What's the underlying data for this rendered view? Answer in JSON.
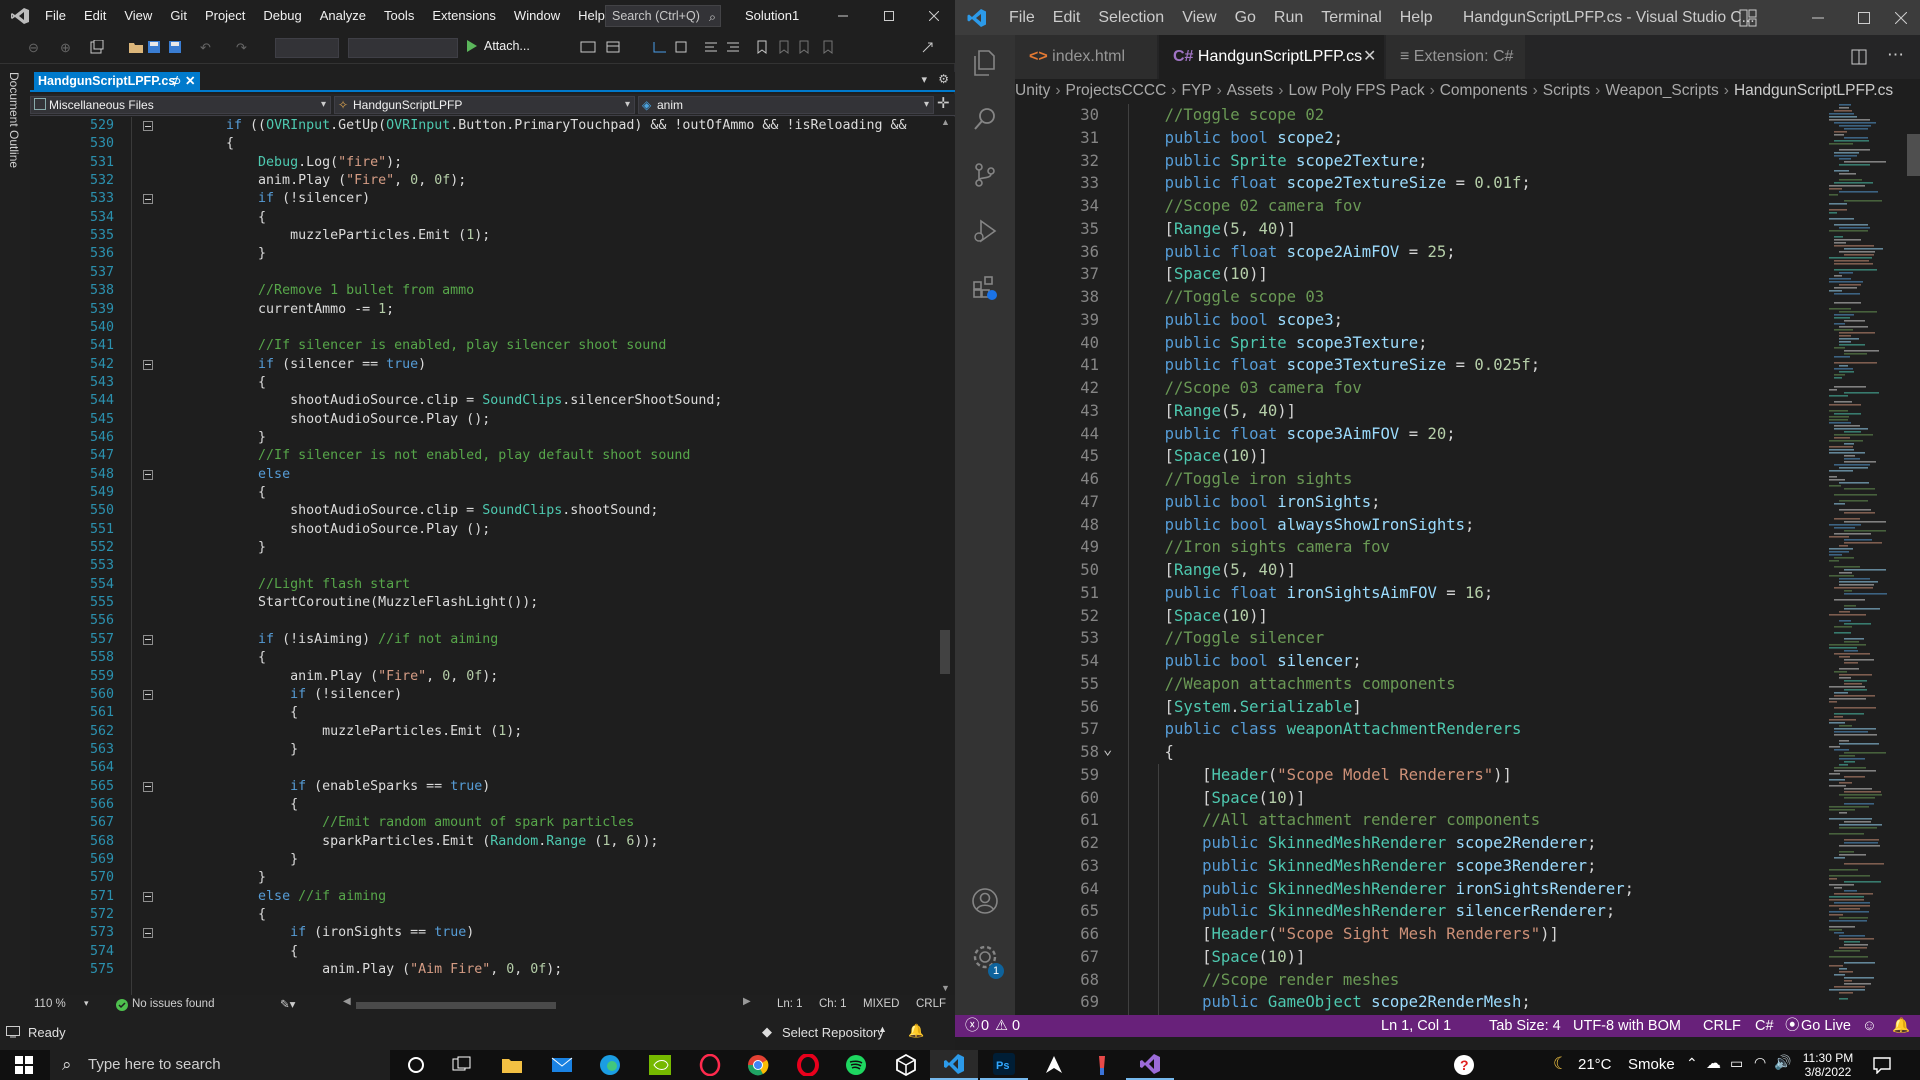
{
  "vs": {
    "menu": [
      "File",
      "Edit",
      "View",
      "Git",
      "Project",
      "Debug",
      "Analyze",
      "Tools",
      "Extensions",
      "Window",
      "Help"
    ],
    "search_placeholder": "Search (Ctrl+Q)",
    "solution_name": "Solution1",
    "attach_label": "Attach...",
    "document_outline_label": "Document Outline",
    "tab_title": "HandgunScriptLPFP.cs",
    "nav_project": "Miscellaneous Files",
    "nav_type": "HandgunScriptLPFP",
    "nav_member": "anim",
    "zoom": "110 %",
    "issues": "No issues found",
    "ln": "Ln: 1",
    "ch": "Ch: 1",
    "whitespace": "MIXED",
    "line_ending": "CRLF",
    "status_ready": "Ready",
    "select_repository": "Select Repository",
    "code_lines": [
      {
        "n": "529",
        "fold": true,
        "t": "    if ((OVRInput.GetUp(OVRInput.Button.PrimaryTouchpad) && !outOfAmmo && !isReloading &&"
      },
      {
        "n": "530",
        "t": "    {"
      },
      {
        "n": "531",
        "t": "        Debug.Log(\"fire\");"
      },
      {
        "n": "532",
        "t": "        anim.Play (\"Fire\", 0, 0f);"
      },
      {
        "n": "533",
        "fold": true,
        "t": "        if (!silencer)"
      },
      {
        "n": "534",
        "t": "        {"
      },
      {
        "n": "535",
        "t": "            muzzleParticles.Emit (1);"
      },
      {
        "n": "536",
        "t": "        }"
      },
      {
        "n": "537",
        "t": ""
      },
      {
        "n": "538",
        "t": "        //Remove 1 bullet from ammo"
      },
      {
        "n": "539",
        "t": "        currentAmmo -= 1;"
      },
      {
        "n": "540",
        "t": ""
      },
      {
        "n": "541",
        "t": "        //If silencer is enabled, play silencer shoot sound"
      },
      {
        "n": "542",
        "fold": true,
        "t": "        if (silencer == true)"
      },
      {
        "n": "543",
        "t": "        {"
      },
      {
        "n": "544",
        "t": "            shootAudioSource.clip = SoundClips.silencerShootSound;"
      },
      {
        "n": "545",
        "t": "            shootAudioSource.Play ();"
      },
      {
        "n": "546",
        "t": "        }"
      },
      {
        "n": "547",
        "t": "        //If silencer is not enabled, play default shoot sound"
      },
      {
        "n": "548",
        "fold": true,
        "t": "        else"
      },
      {
        "n": "549",
        "t": "        {"
      },
      {
        "n": "550",
        "t": "            shootAudioSource.clip = SoundClips.shootSound;"
      },
      {
        "n": "551",
        "t": "            shootAudioSource.Play ();"
      },
      {
        "n": "552",
        "t": "        }"
      },
      {
        "n": "553",
        "t": ""
      },
      {
        "n": "554",
        "t": "        //Light flash start"
      },
      {
        "n": "555",
        "t": "        StartCoroutine(MuzzleFlashLight());"
      },
      {
        "n": "556",
        "t": ""
      },
      {
        "n": "557",
        "fold": true,
        "t": "        if (!isAiming) //if not aiming"
      },
      {
        "n": "558",
        "t": "        {"
      },
      {
        "n": "559",
        "t": "            anim.Play (\"Fire\", 0, 0f);"
      },
      {
        "n": "560",
        "fold": true,
        "t": "            if (!silencer)"
      },
      {
        "n": "561",
        "t": "            {"
      },
      {
        "n": "562",
        "t": "                muzzleParticles.Emit (1);"
      },
      {
        "n": "563",
        "t": "            }"
      },
      {
        "n": "564",
        "t": ""
      },
      {
        "n": "565",
        "fold": true,
        "t": "            if (enableSparks == true)"
      },
      {
        "n": "566",
        "t": "            {"
      },
      {
        "n": "567",
        "t": "                //Emit random amount of spark particles"
      },
      {
        "n": "568",
        "t": "                sparkParticles.Emit (Random.Range (1, 6));"
      },
      {
        "n": "569",
        "t": "            }"
      },
      {
        "n": "570",
        "t": "        }"
      },
      {
        "n": "571",
        "fold": true,
        "t": "        else //if aiming"
      },
      {
        "n": "572",
        "t": "        {"
      },
      {
        "n": "573",
        "fold": true,
        "t": "            if (ironSights == true)"
      },
      {
        "n": "574",
        "t": "            {"
      },
      {
        "n": "575",
        "t": "                anim.Play (\"Aim Fire\", 0, 0f);"
      }
    ]
  },
  "vsc": {
    "menu": [
      "File",
      "Edit",
      "Selection",
      "View",
      "Go",
      "Run",
      "Terminal",
      "Help"
    ],
    "window_title": "HandgunScriptLPFP.cs - Visual Studio C...",
    "tabs": [
      {
        "label": "index.html",
        "active": false
      },
      {
        "label": "HandgunScriptLPFP.cs",
        "active": true
      },
      {
        "label": "Extension: C#",
        "active": false
      }
    ],
    "breadcrumb": [
      "Unity",
      "ProjectsCCCC",
      "FYP",
      "Assets",
      "Low Poly FPS Pack",
      "Components",
      "Scripts",
      "Weapon_Scripts",
      "HandgunScriptLPFP.cs"
    ],
    "status": {
      "errors": "0",
      "warnings": "0",
      "position": "Ln 1, Col 1",
      "tab_size": "Tab Size: 4",
      "encoding": "UTF-8 with BOM",
      "eol": "CRLF",
      "language": "C#",
      "go_live": "Go Live"
    },
    "settings_badge": "1",
    "code_lines": [
      {
        "n": "30",
        "t": "    //Toggle scope 02"
      },
      {
        "n": "31",
        "t": "    public bool scope2;"
      },
      {
        "n": "32",
        "t": "    public Sprite scope2Texture;"
      },
      {
        "n": "33",
        "t": "    public float scope2TextureSize = 0.01f;"
      },
      {
        "n": "34",
        "t": "    //Scope 02 camera fov"
      },
      {
        "n": "35",
        "t": "    [Range(5, 40)]"
      },
      {
        "n": "36",
        "t": "    public float scope2AimFOV = 25;"
      },
      {
        "n": "37",
        "t": "    [Space(10)]"
      },
      {
        "n": "38",
        "t": "    //Toggle scope 03"
      },
      {
        "n": "39",
        "t": "    public bool scope3;"
      },
      {
        "n": "40",
        "t": "    public Sprite scope3Texture;"
      },
      {
        "n": "41",
        "t": "    public float scope3TextureSize = 0.025f;"
      },
      {
        "n": "42",
        "t": "    //Scope 03 camera fov"
      },
      {
        "n": "43",
        "t": "    [Range(5, 40)]"
      },
      {
        "n": "44",
        "t": "    public float scope3AimFOV = 20;"
      },
      {
        "n": "45",
        "t": "    [Space(10)]"
      },
      {
        "n": "46",
        "t": "    //Toggle iron sights"
      },
      {
        "n": "47",
        "t": "    public bool ironSights;"
      },
      {
        "n": "48",
        "t": "    public bool alwaysShowIronSights;"
      },
      {
        "n": "49",
        "t": "    //Iron sights camera fov"
      },
      {
        "n": "50",
        "t": "    [Range(5, 40)]"
      },
      {
        "n": "51",
        "t": "    public float ironSightsAimFOV = 16;"
      },
      {
        "n": "52",
        "t": "    [Space(10)]"
      },
      {
        "n": "53",
        "t": "    //Toggle silencer"
      },
      {
        "n": "54",
        "t": "    public bool silencer;"
      },
      {
        "n": "55",
        "t": "    //Weapon attachments components"
      },
      {
        "n": "56",
        "t": "    [System.Serializable]"
      },
      {
        "n": "57",
        "t": "    public class weaponAttachmentRenderers"
      },
      {
        "n": "58",
        "fold": true,
        "t": "    {"
      },
      {
        "n": "59",
        "t": "        [Header(\"Scope Model Renderers\")]"
      },
      {
        "n": "60",
        "t": "        [Space(10)]"
      },
      {
        "n": "61",
        "t": "        //All attachment renderer components"
      },
      {
        "n": "62",
        "t": "        public SkinnedMeshRenderer scope2Renderer;"
      },
      {
        "n": "63",
        "t": "        public SkinnedMeshRenderer scope3Renderer;"
      },
      {
        "n": "64",
        "t": "        public SkinnedMeshRenderer ironSightsRenderer;"
      },
      {
        "n": "65",
        "t": "        public SkinnedMeshRenderer silencerRenderer;"
      },
      {
        "n": "66",
        "t": "        [Header(\"Scope Sight Mesh Renderers\")]"
      },
      {
        "n": "67",
        "t": "        [Space(10)]"
      },
      {
        "n": "68",
        "t": "        //Scope render meshes"
      },
      {
        "n": "69",
        "t": "        public GameObject scope2RenderMesh;"
      }
    ]
  },
  "taskbar": {
    "search_placeholder": "Type here to search",
    "temperature": "21°C",
    "weather": "Smoke",
    "time": "11:30 PM",
    "date": "3/8/2022"
  },
  "colors": {
    "vs_accent": "#007acc",
    "vsc_statusbar": "#68217a",
    "keyword": "#569cd6",
    "comment": "#57a64a",
    "string": "#d69d85",
    "type": "#4ec9b0"
  }
}
